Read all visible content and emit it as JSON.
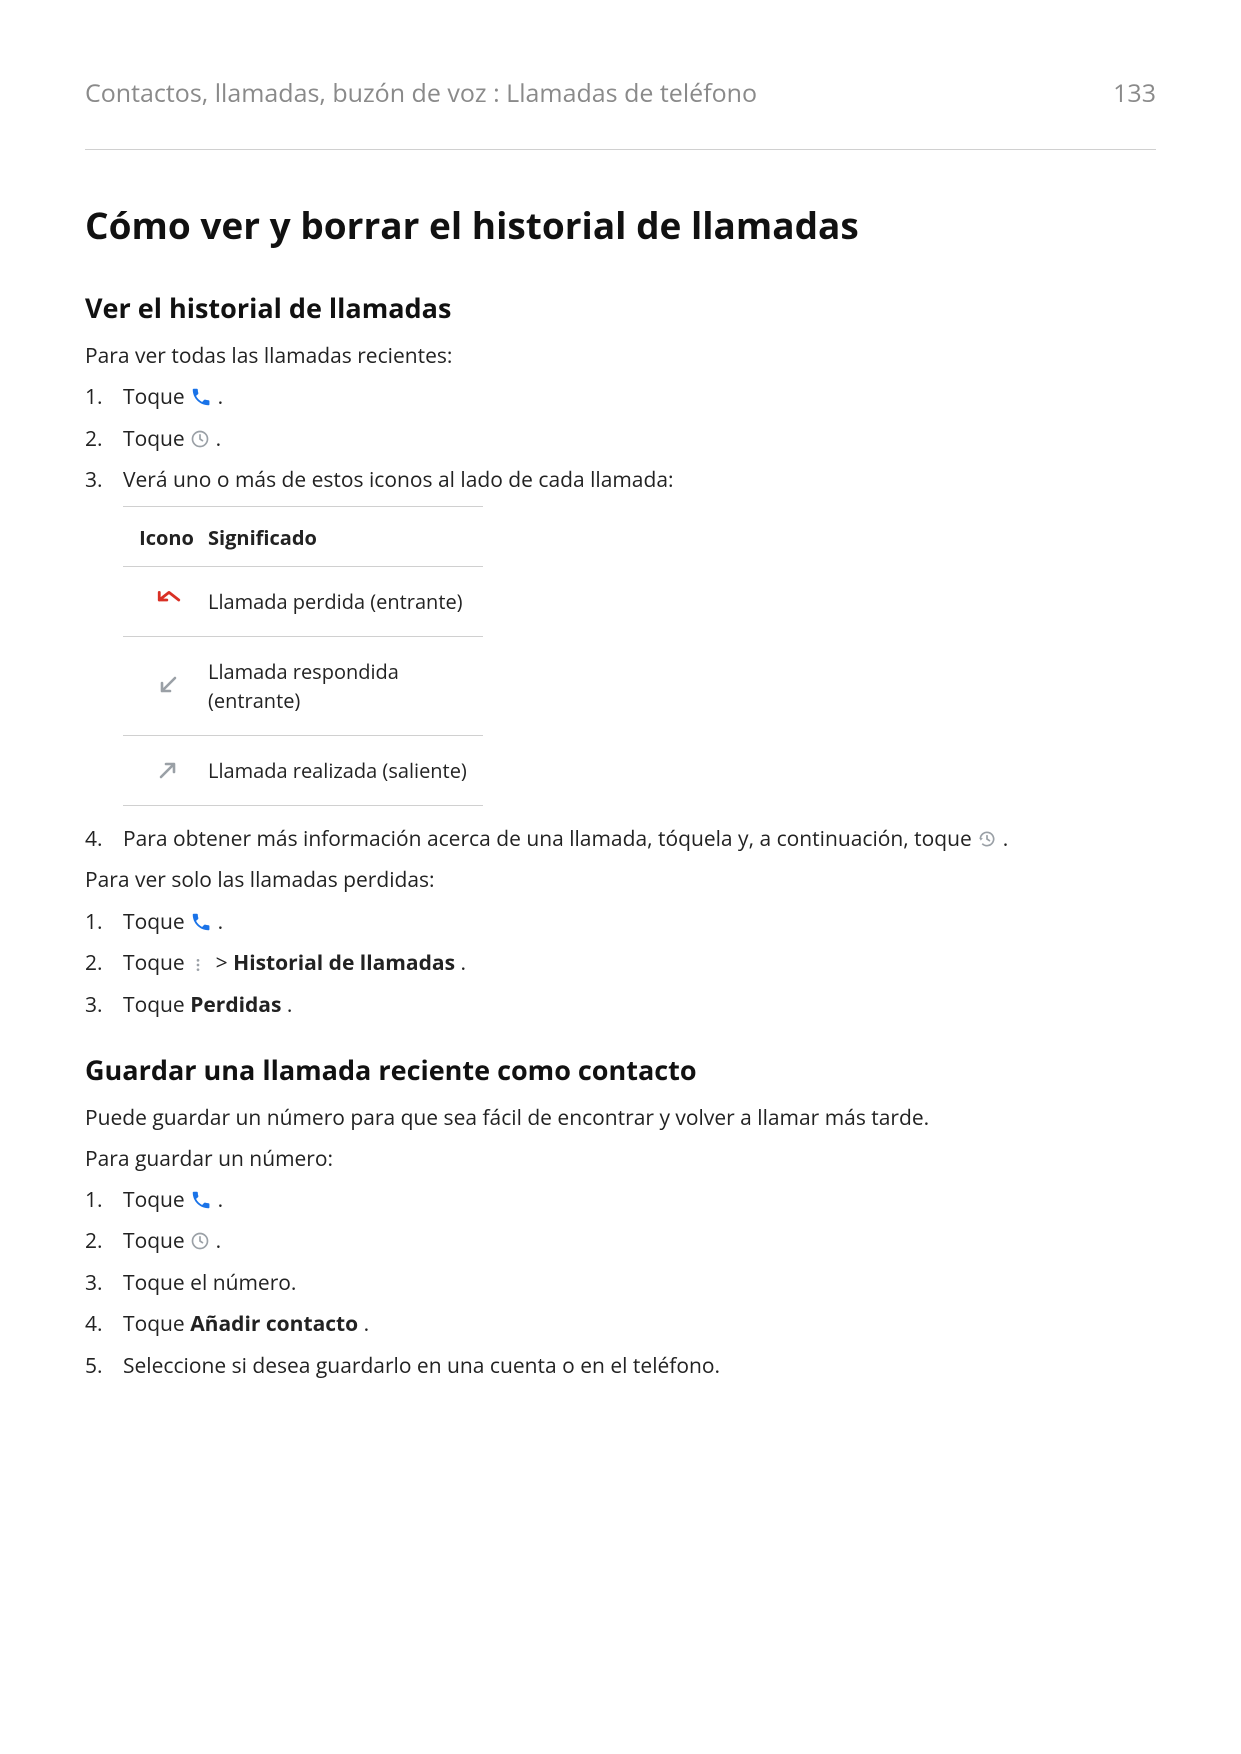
{
  "header": {
    "breadcrumb": "Contactos, llamadas, buzón de voz : Llamadas de teléfono",
    "page_number": "133"
  },
  "h1": "Cómo ver y borrar el historial de llamadas",
  "section_view": {
    "heading": "Ver el historial de llamadas",
    "intro": "Para ver todas las llamadas recientes:",
    "steps": {
      "s1_prefix": "Toque ",
      "s1_suffix": ".",
      "s2_prefix": "Toque ",
      "s2_suffix": ".",
      "s3": "Verá uno o más de estos iconos al lado de cada llamada:",
      "s4_prefix": "Para obtener más información acerca de una llamada, tóquela y, a continuación, toque ",
      "s4_suffix": "."
    },
    "table": {
      "col_icon": "Icono",
      "col_meaning": "Significado",
      "rows": [
        "Llamada perdida (entrante)",
        "Llamada respondida (entrante)",
        "Llamada realizada (saliente)"
      ]
    },
    "missed_intro": "Para ver solo las llamadas perdidas:",
    "missed_steps": {
      "s1_prefix": "Toque ",
      "s1_suffix": ".",
      "s2_prefix": "Toque ",
      "s2_mid": " > ",
      "s2_bold": "Historial de llamadas",
      "s2_suffix": ".",
      "s3_prefix": "Toque ",
      "s3_bold": "Perdidas",
      "s3_suffix": "."
    }
  },
  "section_save": {
    "heading": "Guardar una llamada reciente como contacto",
    "p1": "Puede guardar un número para que sea fácil de encontrar y volver a llamar más tarde.",
    "p2": "Para guardar un número:",
    "steps": {
      "s1_prefix": "Toque ",
      "s1_suffix": ".",
      "s2_prefix": "Toque ",
      "s2_suffix": ".",
      "s3": "Toque el número.",
      "s4_prefix": "Toque ",
      "s4_bold": "Añadir contacto",
      "s4_suffix": ".",
      "s5": "Seleccione si desea guardarlo en una cuenta o en el teléfono."
    }
  },
  "colors": {
    "brand_blue": "#1a73e8",
    "missed_red": "#d93025",
    "muted_grey": "#9aa0a6"
  }
}
